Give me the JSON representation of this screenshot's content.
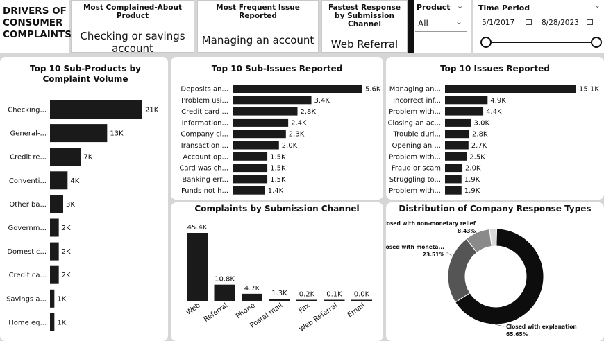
{
  "header": {
    "title_lines": [
      "DRIVERS OF",
      "CONSUMER",
      "COMPLAINTS"
    ]
  },
  "kpis": [
    {
      "label": "Most Complained-About Product",
      "value": "Checking or savings account"
    },
    {
      "label": "Most Frequent Issue Reported",
      "value": "Managing an account"
    },
    {
      "label": "Fastest Response by Submission Channel",
      "value": "Web Referral"
    }
  ],
  "slicers": {
    "product": {
      "label": "Product",
      "selected": "All"
    },
    "time_period": {
      "label": "Time Period",
      "start": "5/1/2017",
      "end": "8/28/2023",
      "slider_start": 0.0,
      "slider_end": 1.0
    }
  },
  "colors": {
    "bar": "#1a1a1a",
    "donut_dark": "#0d0d0d",
    "donut_mid": "#555555",
    "donut_light": "#8a8a8a",
    "donut_pale": "#d9d9d9"
  },
  "chart_data": [
    {
      "id": "subproducts",
      "type": "bar",
      "orientation": "horizontal",
      "title": "Top 10 Sub-Products by Complaint Volume",
      "categories": [
        "Checking...",
        "General-...",
        "Credit re...",
        "Conventi...",
        "Other ba...",
        "Governm...",
        "Domestic...",
        "Credit ca...",
        "Savings a...",
        "Home eq..."
      ],
      "values": [
        21000,
        13000,
        7000,
        4000,
        3000,
        2000,
        2000,
        2000,
        1000,
        1000
      ],
      "value_labels": [
        "21K",
        "13K",
        "7K",
        "4K",
        "3K",
        "2K",
        "2K",
        "2K",
        "1K",
        "1K"
      ]
    },
    {
      "id": "subissues",
      "type": "bar",
      "orientation": "horizontal",
      "title": "Top 10 Sub-Issues Reported",
      "categories": [
        "Deposits an...",
        "Problem usi...",
        "Credit card ...",
        "Information...",
        "Company cl...",
        "Transaction ...",
        "Account op...",
        "Card was ch...",
        "Banking err...",
        "Funds not h..."
      ],
      "values": [
        5600,
        3400,
        2800,
        2400,
        2300,
        2000,
        1500,
        1500,
        1500,
        1400
      ],
      "value_labels": [
        "5.6K",
        "3.4K",
        "2.8K",
        "2.4K",
        "2.3K",
        "2.0K",
        "1.5K",
        "1.5K",
        "1.5K",
        "1.4K"
      ]
    },
    {
      "id": "issues",
      "type": "bar",
      "orientation": "horizontal",
      "title": "Top 10 Issues Reported",
      "categories": [
        "Managing an...",
        "Incorrect inf...",
        "Problem with...",
        "Closing an ac...",
        "Trouble duri...",
        "Opening an ...",
        "Problem with...",
        "Fraud or scam",
        "Struggling to...",
        "Problem with..."
      ],
      "values": [
        15100,
        4900,
        4400,
        3000,
        2800,
        2700,
        2500,
        2000,
        1900,
        1900
      ],
      "value_labels": [
        "15.1K",
        "4.9K",
        "4.4K",
        "3.0K",
        "2.8K",
        "2.7K",
        "2.5K",
        "2.0K",
        "1.9K",
        "1.9K"
      ]
    },
    {
      "id": "channels",
      "type": "bar",
      "orientation": "vertical",
      "title": "Complaints by Submission Channel",
      "categories": [
        "Web",
        "Referral",
        "Phone",
        "Postal mail",
        "Fax",
        "Web Referral",
        "Email"
      ],
      "values": [
        45400,
        10800,
        4700,
        1300,
        200,
        100,
        0
      ],
      "value_labels": [
        "45.4K",
        "10.8K",
        "4.7K",
        "1.3K",
        "0.2K",
        "0.1K",
        "0.0K"
      ]
    },
    {
      "id": "responses",
      "type": "pie",
      "title": "Distribution of Company Response Types",
      "slices": [
        {
          "name": "Closed with explanation",
          "value": 65.65,
          "label": "65.65%"
        },
        {
          "name": "Closed with moneta...",
          "value": 23.51,
          "label": "23.51%"
        },
        {
          "name": "Closed with non-monetary relief",
          "value": 8.43,
          "label": "8.43%"
        },
        {
          "name": "",
          "value": 2.41,
          "label": ""
        }
      ]
    }
  ]
}
